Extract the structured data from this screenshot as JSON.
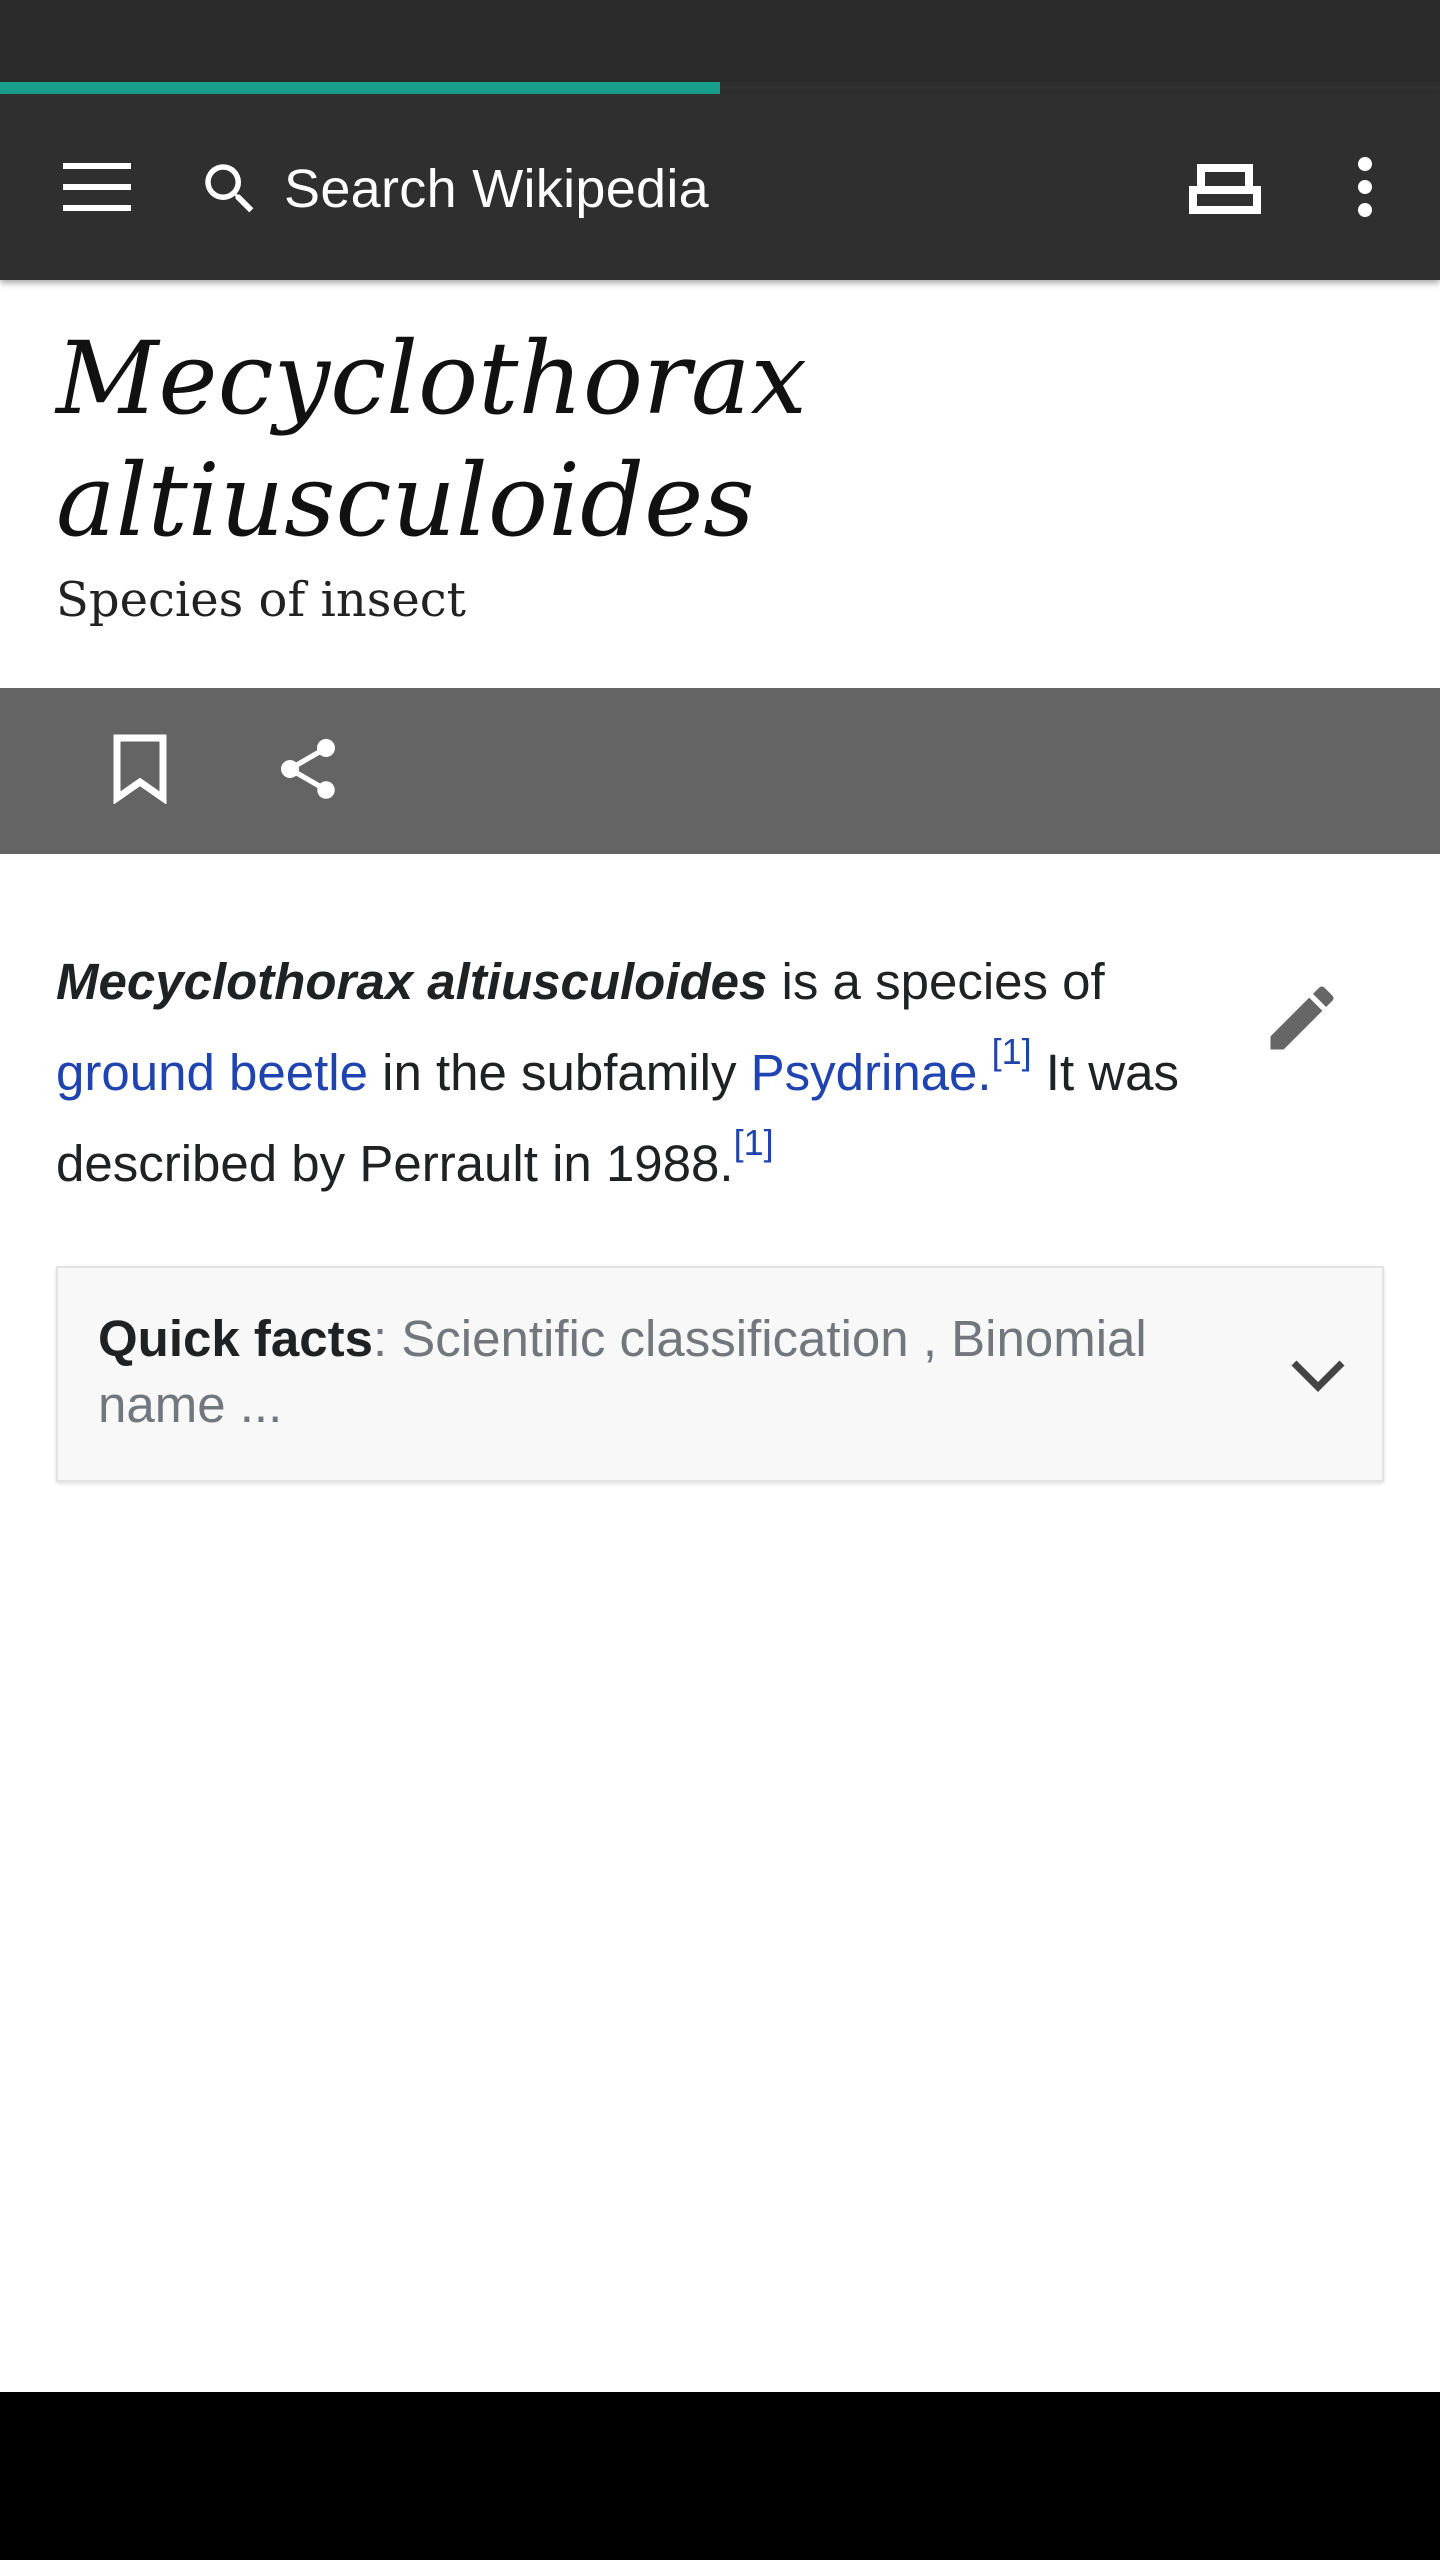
{
  "load_progress": 0.5,
  "toolbar": {
    "search_placeholder": "Search Wikipedia",
    "menu_icon": "hamburger-menu-icon",
    "search_icon": "search-icon",
    "tabs_icon": "tabs-icon",
    "overflow_icon": "more-vert-icon"
  },
  "article": {
    "title": "Mecyclothorax\naltiusculoides",
    "description": "Species of insect",
    "lead": {
      "term": "Mecyclothorax altiusculoides",
      "text1": " is a species of ",
      "link1": "ground beetle",
      "text2": " in the subfamily ",
      "link2": "Psydrinae.",
      "ref1": "[1]",
      "text3": " It was described by Perrault in 1988.",
      "ref2": "[1]"
    },
    "quick_facts": {
      "label": "Quick facts",
      "summary": ": Scientific classification , Binomial name ..."
    }
  },
  "actions": {
    "bookmark_icon": "bookmark-icon",
    "share_icon": "share-icon",
    "edit_icon": "edit-pencil-icon"
  },
  "colors": {
    "accent": "#18a08a",
    "toolbar": "#2f2f2f",
    "action_bar": "#646464",
    "link": "#1f44b0"
  }
}
